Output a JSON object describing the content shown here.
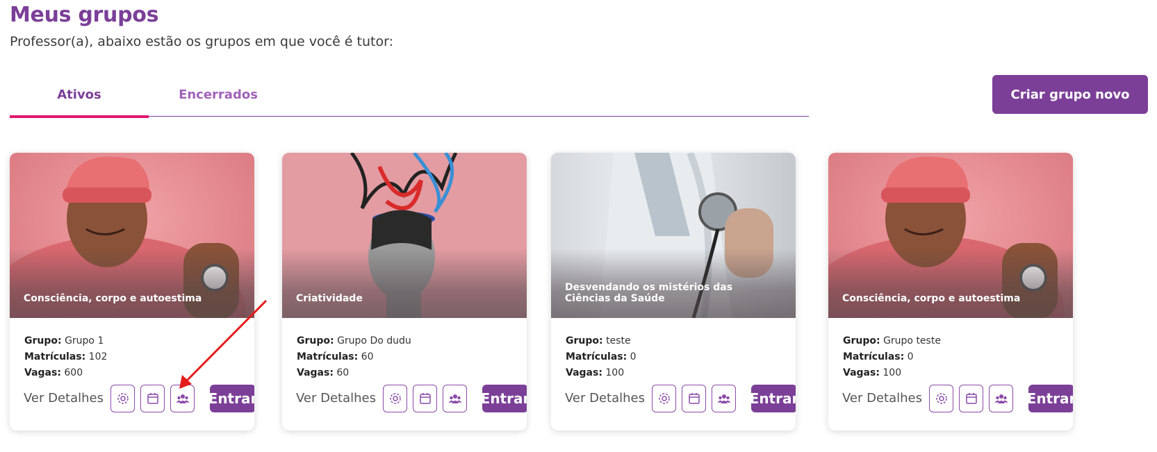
{
  "header": {
    "title": "Meus grupos",
    "subtitle": "Professor(a), abaixo estão os grupos em que você é tutor:"
  },
  "tabs": [
    {
      "label": "Ativos",
      "active": true
    },
    {
      "label": "Encerrados",
      "active": false
    }
  ],
  "create_button": "Criar grupo novo",
  "labels": {
    "group": "Grupo:",
    "enrollments": "Matrículas:",
    "seats": "Vagas:",
    "details": "Ver Detalhes",
    "enter": "Entrar"
  },
  "cards": [
    {
      "title": "Consciência, corpo e autoestima",
      "group": "Grupo 1",
      "enrollments": "102",
      "seats": "600",
      "image": "person-pink"
    },
    {
      "title": "Criatividade",
      "group": "Grupo Do dudu",
      "enrollments": "60",
      "seats": "60",
      "image": "creative-head"
    },
    {
      "title": "Desvendando os mistérios das Ciências da Saúde",
      "group": "teste",
      "enrollments": "0",
      "seats": "100",
      "image": "doctor-stethoscope"
    },
    {
      "title": "Consciência, corpo e autoestima",
      "group": "Grupo teste",
      "enrollments": "0",
      "seats": "100",
      "image": "person-pink"
    }
  ],
  "colors": {
    "brand": "#7b3f98",
    "tab_indicator": "#e0176d",
    "annotation_arrow": "#e51b1b"
  },
  "icons": [
    "gear-icon",
    "calendar-icon",
    "people-icon"
  ]
}
